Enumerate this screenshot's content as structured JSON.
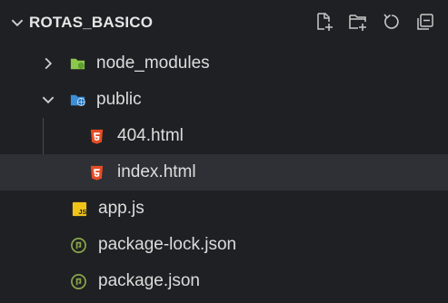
{
  "explorer": {
    "title": "ROTAS_BASICO",
    "actions": [
      {
        "name": "new-file",
        "icon": "new-file-icon"
      },
      {
        "name": "new-folder",
        "icon": "new-folder-icon"
      },
      {
        "name": "refresh",
        "icon": "refresh-icon"
      },
      {
        "name": "collapse-all",
        "icon": "collapse-all-icon"
      }
    ]
  },
  "tree": {
    "items": [
      {
        "label": "node_modules",
        "type": "folder",
        "state": "collapsed",
        "icon": "node-folder-icon"
      },
      {
        "label": "public",
        "type": "folder",
        "state": "expanded",
        "icon": "public-folder-icon"
      },
      {
        "label": "404.html",
        "type": "file",
        "icon": "html-icon"
      },
      {
        "label": "index.html",
        "type": "file",
        "icon": "html-icon",
        "selected": true
      },
      {
        "label": "app.js",
        "type": "file",
        "icon": "js-icon"
      },
      {
        "label": "package-lock.json",
        "type": "file",
        "icon": "npm-json-icon"
      },
      {
        "label": "package.json",
        "type": "file",
        "icon": "npm-json-icon"
      }
    ]
  },
  "colors": {
    "background": "#1f2023",
    "selected_row": "#2e3035",
    "html_orange": "#e44d26",
    "js_yellow": "#f0c419",
    "node_green": "#8cc84b",
    "folder_blue": "#3c8fd6",
    "npm_green": "#8aa64a"
  }
}
